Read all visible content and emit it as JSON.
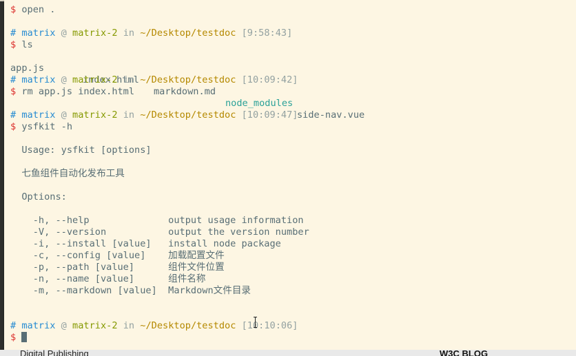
{
  "terminal": {
    "lines": [
      {
        "prompt": "$",
        "cmd": " open ."
      },
      {
        "hash": "#",
        "user": "matrix",
        "at": "@",
        "host": "matrix-2",
        "in": "in",
        "path": "~/Desktop/testdoc",
        "time": "[9:58:43]"
      },
      {
        "prompt": "$",
        "cmd": " ls"
      },
      {
        "ls": [
          "app.js",
          "index.html",
          "markdown.md",
          "node_modules",
          "side-nav.vue"
        ]
      },
      {
        "hash": "#",
        "user": "matrix",
        "at": "@",
        "host": "matrix-2",
        "in": "in",
        "path": "~/Desktop/testdoc",
        "time": "[10:09:42]"
      },
      {
        "prompt": "$",
        "cmd": " rm app.js index.html"
      },
      {
        "hash": "#",
        "user": "matrix",
        "at": "@",
        "host": "matrix-2",
        "in": "in",
        "path": "~/Desktop/testdoc",
        "time": "[10:09:47]"
      },
      {
        "prompt": "$",
        "cmd": " ysfkit -h"
      }
    ],
    "help": {
      "usage": "  Usage: ysfkit [options]",
      "description": "  七鱼组件自动化发布工具",
      "options_header": "  Options:",
      "options": [
        "    -h, --help              output usage information",
        "    -V, --version           output the version number",
        "    -i, --install [value]   install node package",
        "    -c, --config [value]    加载配置文件",
        "    -p, --path [value]      组件文件位置",
        "    -n, --name [value]      组件名称",
        "    -m, --markdown [value]  Markdown文件目录"
      ]
    },
    "last_prompt": {
      "hash": "#",
      "user": "matrix",
      "at": "@",
      "host": "matrix-2",
      "in": "in",
      "path": "~/Desktop/testdoc",
      "time": "[10:10:06]"
    },
    "input_prompt": "$"
  },
  "background_window": {
    "left_text": "Digital Publishing",
    "right_text": "W3C BLOG"
  },
  "colors": {
    "background": "#fdf6e3",
    "prompt_red": "#dc322f",
    "user_blue": "#268bd2",
    "host_green": "#859900",
    "path_yellow": "#b58900",
    "time_gray": "#93a1a1",
    "dir_cyan": "#2aa198",
    "text": "#586e75"
  }
}
